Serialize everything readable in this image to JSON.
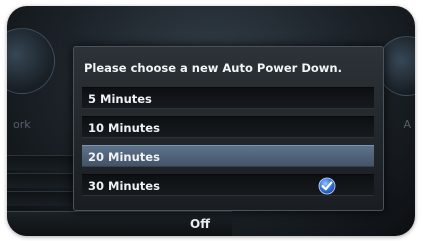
{
  "background": {
    "left_label": "ork",
    "right_label": "A",
    "off_label": "Off"
  },
  "dialog": {
    "title": "Please choose a new Auto Power Down.",
    "options": [
      {
        "label": "5 Minutes",
        "selected": false,
        "checked": false
      },
      {
        "label": "10 Minutes",
        "selected": false,
        "checked": false
      },
      {
        "label": "20 Minutes",
        "selected": true,
        "checked": false
      },
      {
        "label": "30 Minutes",
        "selected": false,
        "checked": true
      }
    ],
    "check_icon": "checkmark-icon",
    "colors": {
      "highlight": "#5d728b",
      "check": "#2f6bd6"
    }
  }
}
